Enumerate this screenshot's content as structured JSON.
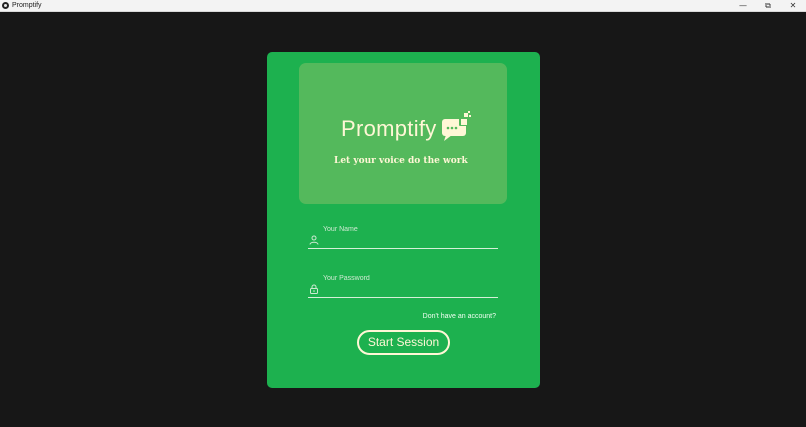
{
  "window": {
    "title": "Promptify",
    "controls": {
      "minimize": "—",
      "maximize": "⧉",
      "close": "✕"
    }
  },
  "brand": {
    "name": "Promptify",
    "tagline": "Let your voice do the work",
    "logo_icon": "chat-bubble-icon"
  },
  "form": {
    "name_placeholder": "Your Name",
    "name_icon": "user-icon",
    "password_placeholder": "Your Password",
    "password_icon": "lock-icon",
    "signup_link": "Don't have an account?",
    "submit_label": "Start Session"
  },
  "colors": {
    "background": "#171717",
    "card": "#1db14f",
    "banner": "#54b95c",
    "accent_text": "#fff7d6"
  }
}
